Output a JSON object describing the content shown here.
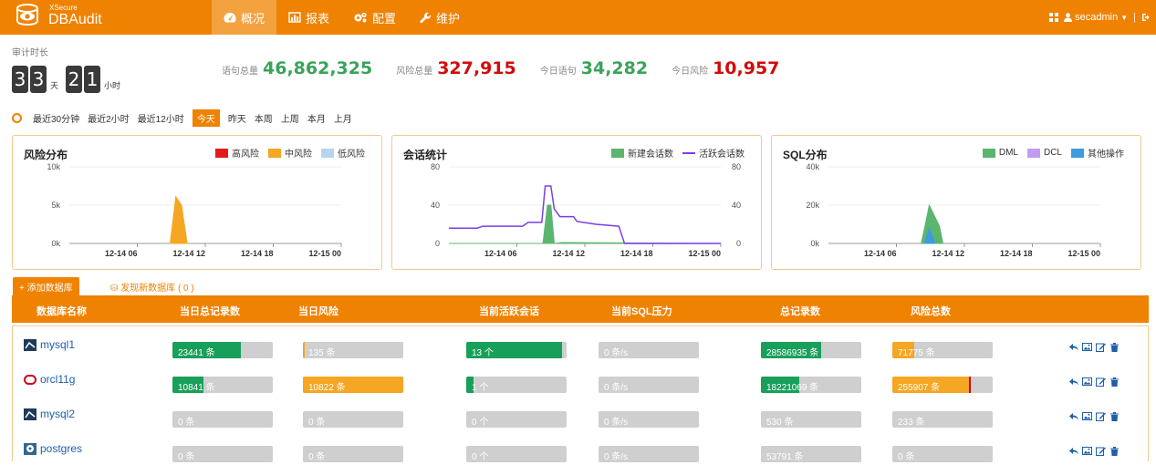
{
  "header": {
    "brand_small": "XSecure",
    "brand_big": "DBAudit",
    "nav": [
      {
        "label": "概况",
        "icon": "dashboard-icon",
        "active": true
      },
      {
        "label": "报表",
        "icon": "bar-chart-icon",
        "active": false
      },
      {
        "label": "配置",
        "icon": "gears-icon",
        "active": false
      },
      {
        "label": "维护",
        "icon": "wrench-icon",
        "active": false
      }
    ],
    "user": "secadmin",
    "separator": "|"
  },
  "stats": {
    "audit_duration_label": "审计时长",
    "days_digits": [
      "3",
      "3"
    ],
    "days_unit": "天",
    "hours_digits": [
      "2",
      "1"
    ],
    "hours_unit": "小时",
    "items": [
      {
        "label": "语句总量",
        "value": "46,862,325",
        "color": "green"
      },
      {
        "label": "风险总量",
        "value": "327,915",
        "color": "red"
      },
      {
        "label": "今日语句",
        "value": "34,282",
        "color": "green"
      },
      {
        "label": "今日风险",
        "value": "10,957",
        "color": "red"
      }
    ]
  },
  "time_filter": {
    "options": [
      "最近30分钟",
      "最近2小时",
      "最近12小时",
      "今天",
      "昨天",
      "本周",
      "上周",
      "本月",
      "上月"
    ],
    "active": "今天"
  },
  "chart_data": [
    {
      "type": "area",
      "title": "风险分布",
      "x_ticks": [
        "12-14 06",
        "12-14 12",
        "12-14 18",
        "12-15 00"
      ],
      "y_ticks": [
        "10k",
        "5k",
        "0k"
      ],
      "ylim": [
        0,
        10000
      ],
      "x_range": [
        0,
        24
      ],
      "series": [
        {
          "name": "高风险",
          "color": "#e31a1c",
          "points": []
        },
        {
          "name": "中风险",
          "color": "#f5a623",
          "points": [
            [
              8.9,
              0
            ],
            [
              9.4,
              6100
            ],
            [
              9.9,
              5000
            ],
            [
              10.4,
              0
            ]
          ]
        },
        {
          "name": "低风险",
          "color": "#b7d3f0",
          "points": []
        }
      ]
    },
    {
      "type": "line",
      "title": "会话统计",
      "x_ticks": [
        "12-14 06",
        "12-14 12",
        "12-14 18",
        "12-15 00"
      ],
      "y_ticks_left": [
        "80",
        "40",
        "0"
      ],
      "y_ticks_right": [
        "80",
        "40",
        "0"
      ],
      "ylim": [
        0,
        80
      ],
      "x_range": [
        0,
        24
      ],
      "series": [
        {
          "name": "新建会话数",
          "color": "#5bb56f",
          "style": "area",
          "points": [
            [
              0,
              0
            ],
            [
              8.3,
              0
            ],
            [
              8.7,
              40
            ],
            [
              9.0,
              40
            ],
            [
              9.3,
              0
            ],
            [
              10,
              1
            ],
            [
              24,
              0
            ]
          ]
        },
        {
          "name": "活跃会话数",
          "color": "#7b3fe4",
          "style": "line",
          "points": [
            [
              0,
              16
            ],
            [
              2.5,
              16
            ],
            [
              3,
              18
            ],
            [
              6.5,
              18
            ],
            [
              7,
              22
            ],
            [
              8.2,
              22
            ],
            [
              8.5,
              60
            ],
            [
              9.0,
              60
            ],
            [
              9.3,
              36
            ],
            [
              9.8,
              28
            ],
            [
              11,
              28
            ],
            [
              11.3,
              23
            ],
            [
              13,
              20
            ],
            [
              15,
              18
            ],
            [
              15.5,
              0
            ],
            [
              24,
              0
            ]
          ]
        }
      ]
    },
    {
      "type": "area",
      "title": "SQL分布",
      "x_ticks": [
        "12-14 06",
        "12-14 12",
        "12-14 18",
        "12-15 00"
      ],
      "y_ticks": [
        "40k",
        "20k",
        "0k"
      ],
      "ylim": [
        0,
        40000
      ],
      "x_range": [
        0,
        24
      ],
      "series": [
        {
          "name": "DML",
          "color": "#5bb56f",
          "points": [
            [
              8.2,
              0
            ],
            [
              8.9,
              20000
            ],
            [
              9.8,
              9000
            ],
            [
              10.1,
              0
            ]
          ]
        },
        {
          "name": "DCL",
          "color": "#c29bf2",
          "points": []
        },
        {
          "name": "其他操作",
          "color": "#3e9be0",
          "points": [
            [
              8.5,
              0
            ],
            [
              8.9,
              8000
            ],
            [
              9.4,
              0
            ]
          ]
        }
      ]
    }
  ],
  "toolbar": {
    "add_db": "+ 添加数据库",
    "discover": "发现新数据库 ( 0 )"
  },
  "table": {
    "headers": [
      "数据库名称",
      "当日总记录数",
      "当日风险",
      "当前活跃会话",
      "当前SQL压力",
      "总记录数",
      "风险总数"
    ],
    "rows": [
      {
        "name": "mysql1",
        "icon": "mysql-icon",
        "records": {
          "text": "23441 条",
          "fill": 0.68,
          "color": "#18a05a"
        },
        "risk": {
          "text": "135 条",
          "fill": 0.02,
          "color": "#f5a623"
        },
        "sessions": {
          "text": "13 个",
          "fill": 0.95,
          "color": "#18a05a"
        },
        "pressure": {
          "text": "0 条/s",
          "fill": 0,
          "color": "#18a05a"
        },
        "total": {
          "text": "28586935 条",
          "fill": 0.6,
          "color": "#18a05a"
        },
        "risk_total": {
          "text": "71775 条",
          "fill": 0.22,
          "color": "#f5a623"
        }
      },
      {
        "name": "orcl11g",
        "icon": "oracle-icon",
        "records": {
          "text": "10841 条",
          "fill": 0.31,
          "color": "#18a05a"
        },
        "risk": {
          "text": "10822 条",
          "fill": 1.0,
          "color": "#f5a623"
        },
        "sessions": {
          "text": "1 个",
          "fill": 0.07,
          "color": "#18a05a"
        },
        "pressure": {
          "text": "0 条/s",
          "fill": 0,
          "color": "#18a05a"
        },
        "total": {
          "text": "18221069 条",
          "fill": 0.38,
          "color": "#18a05a"
        },
        "risk_total": {
          "text": "255907 条",
          "fill": 0.76,
          "color": "#f5a623",
          "marker": true
        }
      },
      {
        "name": "mysql2",
        "icon": "mysql-icon",
        "records": {
          "text": "0 条",
          "fill": 0,
          "color": "#18a05a"
        },
        "risk": {
          "text": "0 条",
          "fill": 0,
          "color": "#f5a623"
        },
        "sessions": {
          "text": "0 个",
          "fill": 0,
          "color": "#18a05a"
        },
        "pressure": {
          "text": "0 条/s",
          "fill": 0,
          "color": "#18a05a"
        },
        "total": {
          "text": "530 条",
          "fill": 0,
          "color": "#18a05a"
        },
        "risk_total": {
          "text": "233 条",
          "fill": 0,
          "color": "#f5a623"
        }
      },
      {
        "name": "postgres",
        "icon": "postgres-icon",
        "records": {
          "text": "0 条",
          "fill": 0,
          "color": "#18a05a"
        },
        "risk": {
          "text": "0 条",
          "fill": 0,
          "color": "#f5a623"
        },
        "sessions": {
          "text": "0 个",
          "fill": 0,
          "color": "#18a05a"
        },
        "pressure": {
          "text": "0 条/s",
          "fill": 0,
          "color": "#18a05a"
        },
        "total": {
          "text": "53791 条",
          "fill": 0,
          "color": "#18a05a"
        },
        "risk_total": {
          "text": "0 条",
          "fill": 0,
          "color": "#f5a623"
        }
      }
    ]
  },
  "colors": {
    "brand": "#ef8200",
    "link": "#1d5fa8"
  }
}
